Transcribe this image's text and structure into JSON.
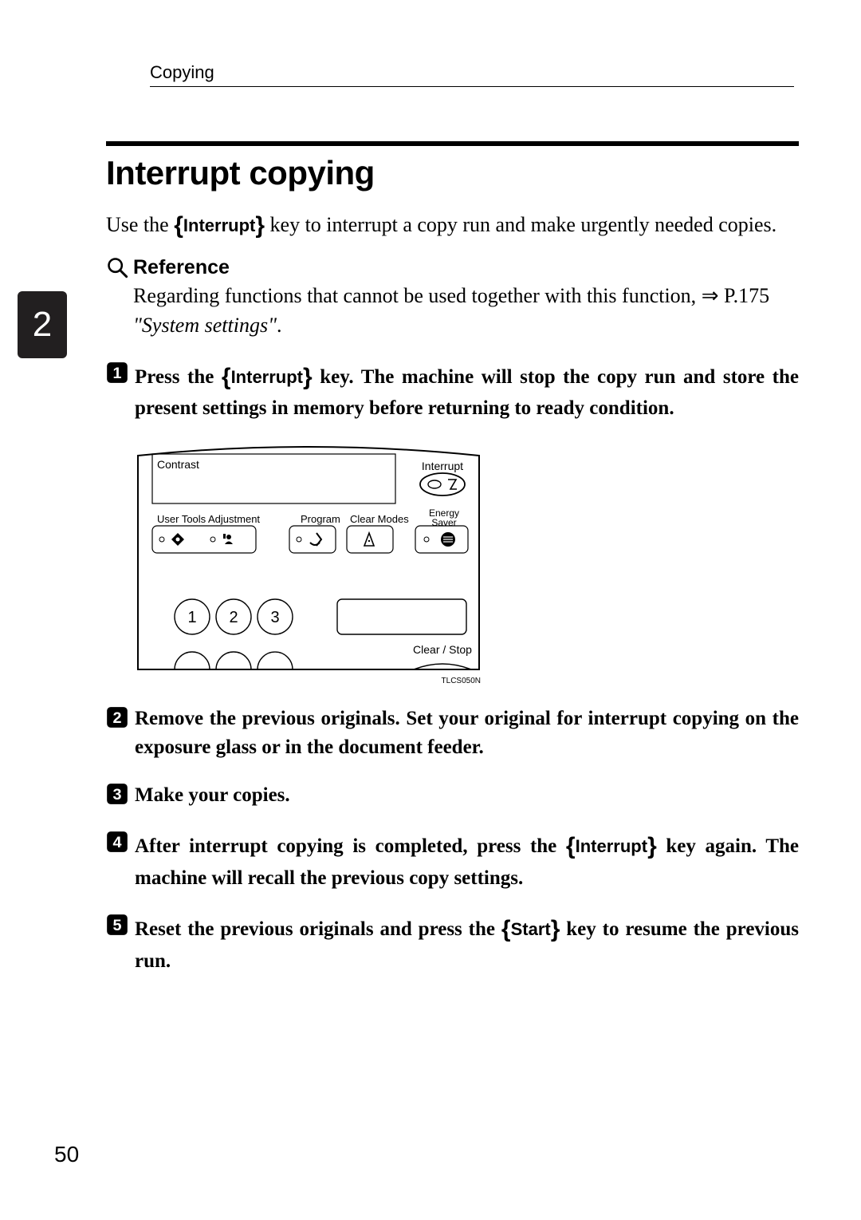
{
  "runningHead": "Copying",
  "chapterTab": "2",
  "pageNumber": "50",
  "section": {
    "title": "Interrupt copying",
    "intro": {
      "pre": "Use the ",
      "keyLabel": "Interrupt",
      "post": " key to interrupt a copy run and make urgently needed copies."
    }
  },
  "reference": {
    "heading": "Reference",
    "line1_pre": "Regarding functions that cannot be used together with this function, ",
    "line1_arrow": "⇒",
    "line1_post": " P.175 ",
    "line2": "\"System settings\"",
    "line2_post": "."
  },
  "steps": [
    {
      "num": "1",
      "pre": "Press the ",
      "key": "Interrupt",
      "post": " key. The machine will stop the copy run and store the present settings in memory before returning to ready condition."
    },
    {
      "num": "2",
      "text": "Remove the previous originals. Set your original for interrupt copying on the exposure glass or in the document feeder."
    },
    {
      "num": "3",
      "text": "Make your copies."
    },
    {
      "num": "4",
      "pre": "After interrupt copying is completed, press the ",
      "key": "Interrupt",
      "post": " key again. The machine will recall the previous copy settings."
    },
    {
      "num": "5",
      "pre": "Reset the previous originals and press the ",
      "key": "Start",
      "post": " key to resume the previous run."
    }
  ],
  "panel": {
    "code": "TLCS050N",
    "labels": {
      "contrast": "Contrast",
      "interrupt": "Interrupt",
      "userTools": "User Tools",
      "adjustment": "Adjustment",
      "program": "Program",
      "clearModes": "Clear Modes",
      "energySaver": "Energy\nSaver",
      "clearStop": "Clear / Stop",
      "nums": [
        "1",
        "2",
        "3"
      ]
    }
  }
}
